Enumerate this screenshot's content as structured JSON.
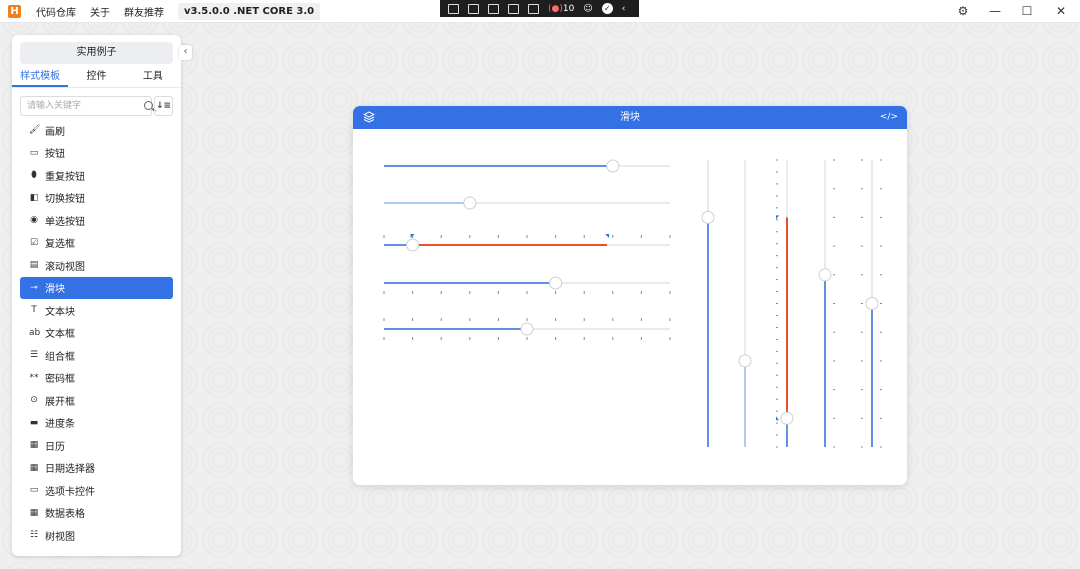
{
  "app": {
    "logo_letter": "H",
    "menu": [
      "代码仓库",
      "关于",
      "群友推荐"
    ],
    "version": "v3.5.0.0 .NET CORE 3.0",
    "recorder_count": "10"
  },
  "sidebar": {
    "examples_button": "实用例子",
    "tabs": [
      {
        "label": "样式模板",
        "active": true
      },
      {
        "label": "控件",
        "active": false
      },
      {
        "label": "工具",
        "active": false
      }
    ],
    "search_placeholder": "请输入关键字",
    "items": [
      {
        "label": "画刷",
        "icon": "brush-icon",
        "glyph": "🖌",
        "active": false
      },
      {
        "label": "按钮",
        "icon": "button-icon",
        "glyph": "▭",
        "active": false
      },
      {
        "label": "重复按钮",
        "icon": "repeat-button-icon",
        "glyph": "⬮",
        "active": false
      },
      {
        "label": "切换按钮",
        "icon": "toggle-button-icon",
        "glyph": "◧",
        "active": false
      },
      {
        "label": "单选按钮",
        "icon": "radio-button-icon",
        "glyph": "◉",
        "active": false
      },
      {
        "label": "复选框",
        "icon": "checkbox-icon",
        "glyph": "☑",
        "active": false
      },
      {
        "label": "滚动视图",
        "icon": "scrollviewer-icon",
        "glyph": "▤",
        "active": false
      },
      {
        "label": "滑块",
        "icon": "slider-icon",
        "glyph": "⊸",
        "active": true
      },
      {
        "label": "文本块",
        "icon": "textblock-icon",
        "glyph": "T",
        "active": false
      },
      {
        "label": "文本框",
        "icon": "textbox-icon",
        "glyph": "ab",
        "active": false
      },
      {
        "label": "组合框",
        "icon": "combobox-icon",
        "glyph": "☰",
        "active": false
      },
      {
        "label": "密码框",
        "icon": "passwordbox-icon",
        "glyph": "**",
        "active": false
      },
      {
        "label": "展开框",
        "icon": "expander-icon",
        "glyph": "⊙",
        "active": false
      },
      {
        "label": "进度条",
        "icon": "progressbar-icon",
        "glyph": "▬",
        "active": false
      },
      {
        "label": "日历",
        "icon": "calendar-icon",
        "glyph": "▦",
        "active": false
      },
      {
        "label": "日期选择器",
        "icon": "datepicker-icon",
        "glyph": "▦",
        "active": false
      },
      {
        "label": "选项卡控件",
        "icon": "tabcontrol-icon",
        "glyph": "▭",
        "active": false
      },
      {
        "label": "数据表格",
        "icon": "datagrid-icon",
        "glyph": "▦",
        "active": false
      },
      {
        "label": "树视图",
        "icon": "treeview-icon",
        "glyph": "☷",
        "active": false
      }
    ]
  },
  "card": {
    "title": "滑块",
    "code_icon": "</>",
    "accent": "#3371e4",
    "range_color": "#e5532b",
    "horizontal_sliders": [
      {
        "type": "simple",
        "value": 0.8
      },
      {
        "type": "thin",
        "value": 0.3
      },
      {
        "type": "range",
        "low": 0.1,
        "high": 0.78,
        "ticks": true
      },
      {
        "type": "ticks-below",
        "value": 0.6
      },
      {
        "type": "ticks-both",
        "value": 0.5
      }
    ],
    "vertical_sliders": [
      {
        "type": "simple",
        "value": 0.8
      },
      {
        "type": "thin",
        "value": 0.3
      },
      {
        "type": "range",
        "low": 0.1,
        "high": 0.8
      },
      {
        "type": "ticks",
        "value": 0.6
      },
      {
        "type": "ticks-both",
        "value": 0.5
      }
    ]
  }
}
